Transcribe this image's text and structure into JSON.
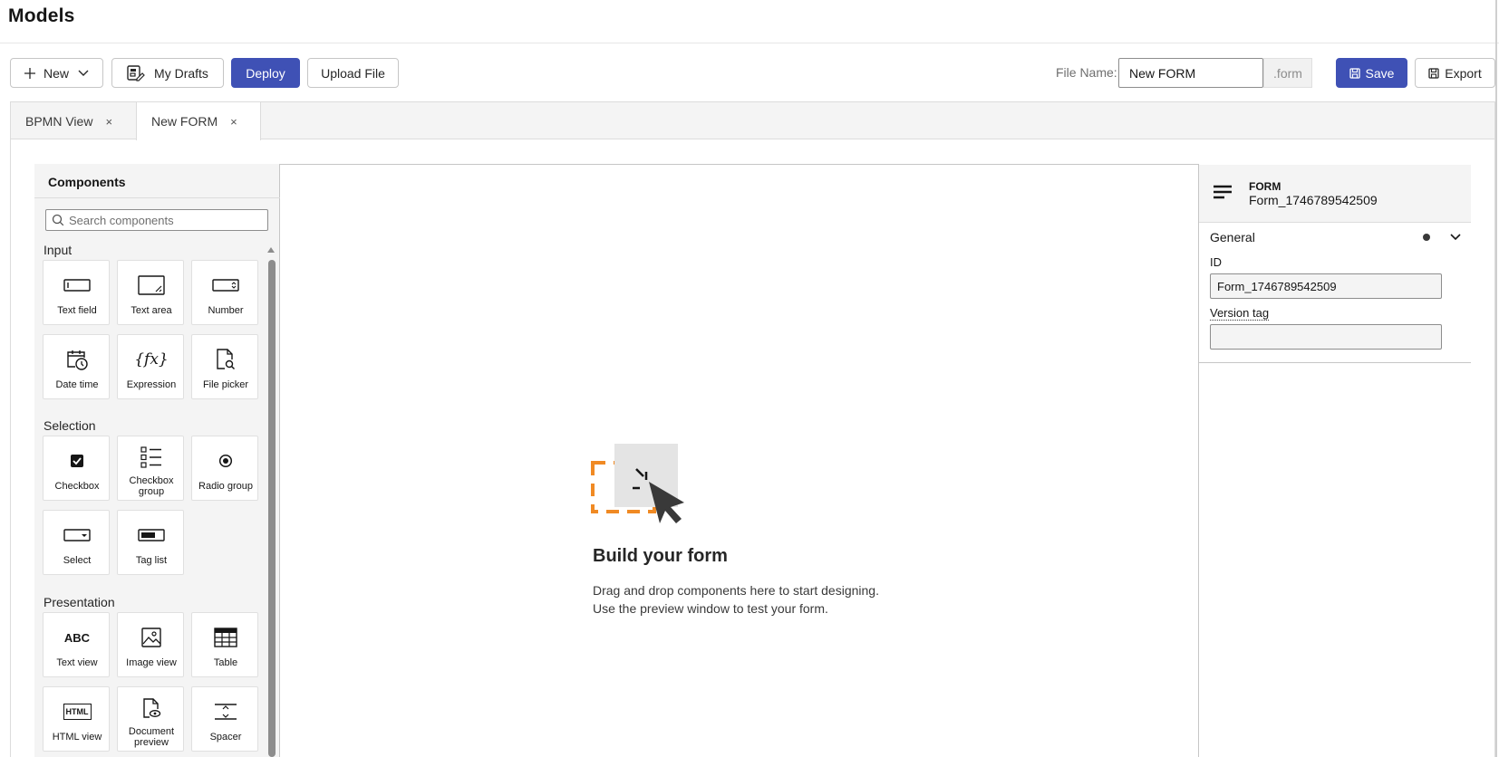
{
  "page": {
    "title": "Models"
  },
  "toolbar": {
    "new_label": "New",
    "drafts_label": "My Drafts",
    "deploy_label": "Deploy",
    "upload_label": "Upload File",
    "file_name_label": "File Name:",
    "file_name_value": "New FORM",
    "file_extension": ".form",
    "save_label": "Save",
    "export_label": "Export",
    "accent_color": "#3f51b5"
  },
  "tabs": [
    {
      "label": "BPMN View",
      "close": "×",
      "active": false
    },
    {
      "label": "New FORM",
      "close": "×",
      "active": true
    }
  ],
  "palette": {
    "title": "Components",
    "search_placeholder": "Search components",
    "groups": [
      {
        "label": "Input",
        "items": [
          {
            "label": "Text field",
            "icon": "textfield-icon"
          },
          {
            "label": "Text area",
            "icon": "textarea-icon"
          },
          {
            "label": "Number",
            "icon": "number-icon"
          },
          {
            "label": "Date time",
            "icon": "datetime-icon"
          },
          {
            "label": "Expression",
            "icon": "expression-icon"
          },
          {
            "label": "File picker",
            "icon": "filepicker-icon"
          }
        ]
      },
      {
        "label": "Selection",
        "items": [
          {
            "label": "Checkbox",
            "icon": "checkbox-icon"
          },
          {
            "label": "Checkbox group",
            "icon": "checklist-icon"
          },
          {
            "label": "Radio group",
            "icon": "radio-icon"
          },
          {
            "label": "Select",
            "icon": "select-icon"
          },
          {
            "label": "Tag list",
            "icon": "taglist-icon"
          }
        ]
      },
      {
        "label": "Presentation",
        "items": [
          {
            "label": "Text view",
            "icon": "text-abc-icon"
          },
          {
            "label": "Image view",
            "icon": "image-icon"
          },
          {
            "label": "Table",
            "icon": "table-icon"
          },
          {
            "label": "HTML view",
            "icon": "html-icon"
          },
          {
            "label": "Document preview",
            "icon": "document-preview-icon"
          },
          {
            "label": "Spacer",
            "icon": "spacer-icon"
          }
        ]
      }
    ],
    "expression_glyph": "{fx}",
    "abc_glyph": "ABC",
    "html_glyph": "HTML"
  },
  "canvas": {
    "empty_title": "Build your form",
    "empty_line1": "Drag and drop components here to start designing.",
    "empty_line2": "Use the preview window to test your form.",
    "drop_accent_color": "#f08a24"
  },
  "properties": {
    "type_label": "FORM",
    "name": "Form_1746789542509",
    "group_label": "General",
    "id_label": "ID",
    "id_value": "Form_1746789542509",
    "version_tag_label": "Version tag",
    "version_tag_value": ""
  }
}
